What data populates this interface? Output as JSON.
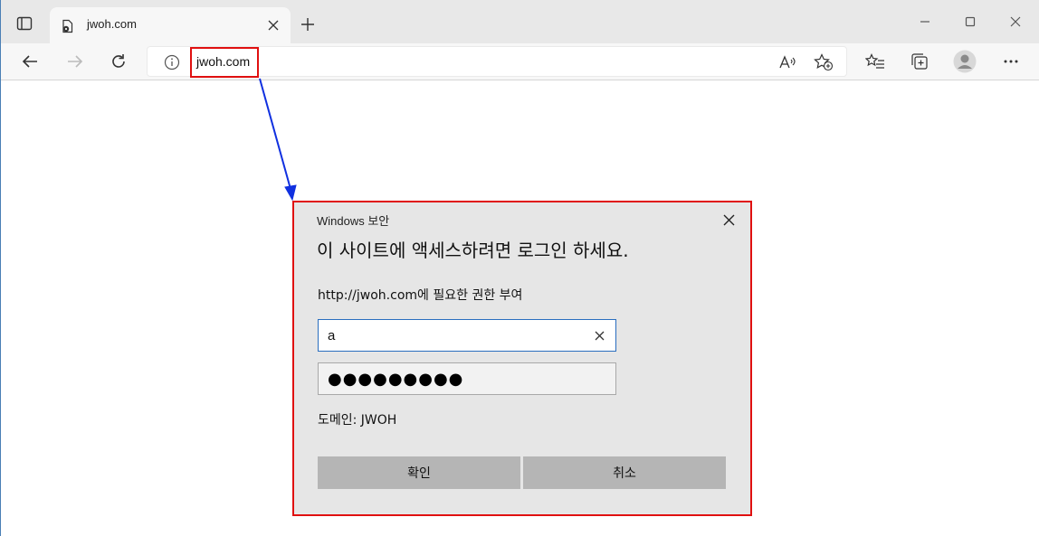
{
  "browser": {
    "tab": {
      "title": "jwoh.com",
      "favicon": "page-gear-icon"
    },
    "address": {
      "url": "jwoh.com"
    },
    "colors": {
      "annotation_box": "#e01010",
      "annotation_arrow": "#1030e0"
    }
  },
  "dialog": {
    "caption": "Windows 보안",
    "heading": "이 사이트에 액세스하려면 로그인 하세요.",
    "subtitle": "http://jwoh.com에 필요한 권한 부여",
    "username_value": "a",
    "password_mask": "●●●●●●●●●",
    "domain_label": "도메인: JWOH",
    "ok_label": "확인",
    "cancel_label": "취소"
  }
}
